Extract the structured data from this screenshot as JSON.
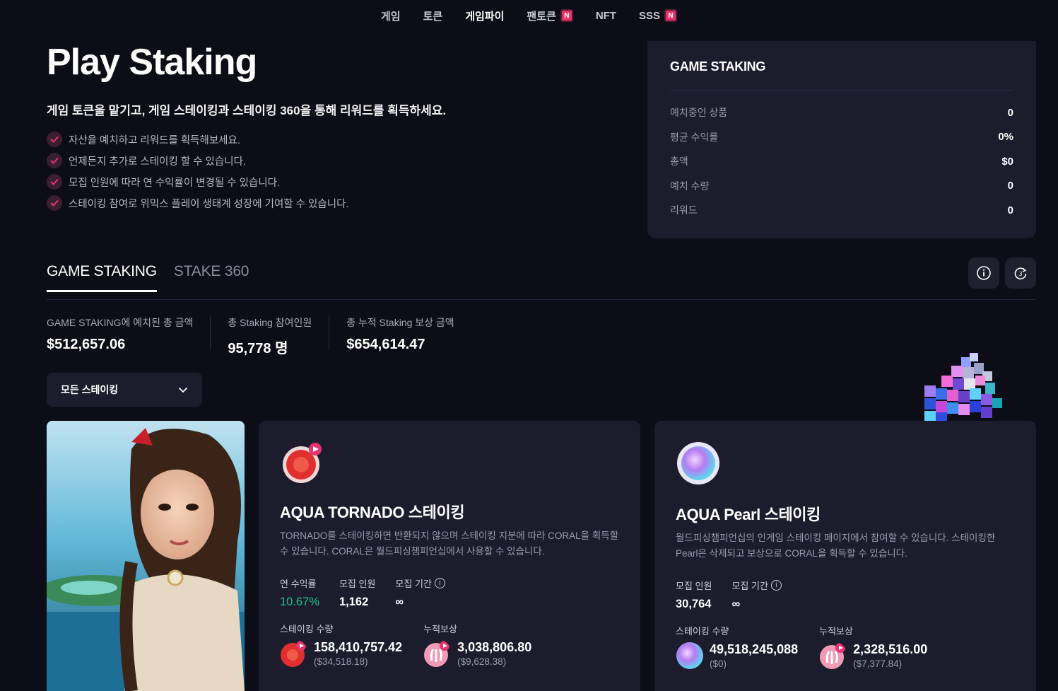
{
  "nav": {
    "items": [
      {
        "label": "게임",
        "badge": ""
      },
      {
        "label": "토큰",
        "badge": ""
      },
      {
        "label": "게임파이",
        "badge": ""
      },
      {
        "label": "팬토큰",
        "badge": "N"
      },
      {
        "label": "NFT",
        "badge": ""
      },
      {
        "label": "SSS",
        "badge": "N"
      }
    ]
  },
  "hero": {
    "title": "Play Staking",
    "subtitle": "게임 토큰을 맡기고, 게임 스테이킹과 스테이킹 360을 통해 리워드를 획득하세요.",
    "bullets": [
      "자산을 예치하고 리워드를 획득해보세요.",
      "언제든지 추가로 스테이킹 할 수 있습니다.",
      "모집 인원에 따라 연 수익률이 변경될 수 있습니다.",
      "스테이킹 참여로 위믹스 플레이 생태계 성장에 기여할 수 있습니다."
    ]
  },
  "summary": {
    "title": "GAME STAKING",
    "rows": [
      {
        "label": "예치중인 상품",
        "value": "0"
      },
      {
        "label": "평균 수익률",
        "value": "0%"
      },
      {
        "label": "총액",
        "value": "$0"
      },
      {
        "label": "예치 수량",
        "value": "0"
      },
      {
        "label": "리워드",
        "value": "0"
      }
    ]
  },
  "tabs": {
    "game_staking": "GAME STAKING",
    "stake_360": "STAKE 360"
  },
  "stats": [
    {
      "label": "GAME STAKING에 예치된 총 금액",
      "value": "$512,657.06"
    },
    {
      "label": "총 Staking 참여인원",
      "value": "95,778 명"
    },
    {
      "label": "총 누적 Staking 보상 금액",
      "value": "$654,614.47"
    }
  ],
  "filter": {
    "selected": "모든 스테이킹"
  },
  "cards": [
    {
      "title": "AQUA TORNADO 스테이킹",
      "description": "TORNADO를 스테이킹하면 반환되지 않으며 스테이킹 지분에 따라 CORAL을 획득할 수 있습니다. CORAL은 월드피싱챔피언십에서 사용할 수 있습니다.",
      "apr_label": "연 수익률",
      "apr_value": "10.67%",
      "recruit_label": "모집 인원",
      "recruit_value": "1,162",
      "period_label": "모집 기간",
      "period_value": "∞",
      "staked_label": "스테이킹 수량",
      "staked_amount": "158,410,757.42",
      "staked_usd": "($34,518.18)",
      "reward_label": "누적보상",
      "reward_amount": "3,038,806.80",
      "reward_usd": "($9,628.38)"
    },
    {
      "title": "AQUA Pearl 스테이킹",
      "description": "월드피싱챔피언십의 인게임 스테이킹 페이지에서 참여할 수 있습니다. 스테이킹한 Pearl은 삭제되고 보상으로 CORAL을 획득할 수 있습니다.",
      "recruit_label": "모집 인원",
      "recruit_value": "30,764",
      "period_label": "모집 기간",
      "period_value": "∞",
      "staked_label": "스테이킹 수량",
      "staked_amount": "49,518,245,088",
      "staked_usd": "($0)",
      "reward_label": "누적보상",
      "reward_amount": "2,328,516.00",
      "reward_usd": "($7,377.84)"
    }
  ],
  "colors": {
    "background": "#0d0d17",
    "panel": "#1c1c2c",
    "accent_pink": "#e8336d",
    "apr_green": "#1fc48a"
  }
}
